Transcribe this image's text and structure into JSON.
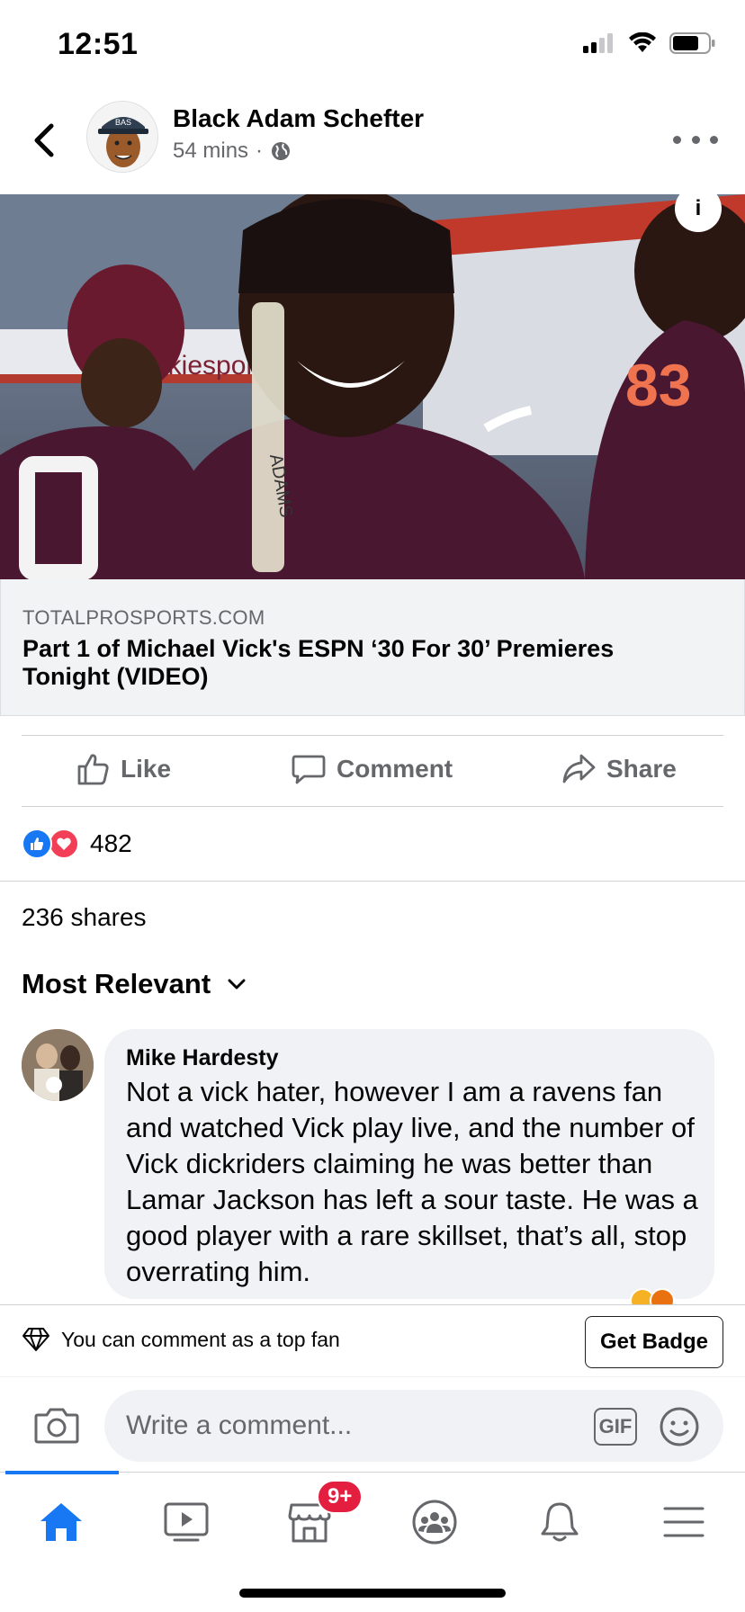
{
  "status_bar": {
    "time": "12:51"
  },
  "post": {
    "author": "Black Adam Schefter",
    "time_ago": "54 mins",
    "separator": "·",
    "avatar_text": "BAS"
  },
  "link": {
    "domain": "TOTALPROSPORTS.COM",
    "title": "Part 1 of Michael Vick's ESPN ‘30 For 30’ Premieres Tonight (VIDEO)",
    "image_text": {
      "jersey_number": "83",
      "sign_text": "okiespor",
      "strap_text": "ADAMS"
    },
    "info_glyph": "i"
  },
  "actions": {
    "like": "Like",
    "comment": "Comment",
    "share": "Share"
  },
  "reactions": {
    "count": "482",
    "types": [
      "like",
      "love"
    ]
  },
  "shares": "236 shares",
  "sort": {
    "label": "Most Relevant"
  },
  "comment": {
    "author": "Mike Hardesty",
    "text": "Not a vick hater, however I am a ravens fan and watched Vick play live, and the number of Vick dickriders claiming he was better than Lamar Jackson has left a sour taste. He was a good player with a rare skillset, that’s all, stop overrating him."
  },
  "top_fan": {
    "message": "You can comment as a top fan",
    "button": "Get Badge"
  },
  "composer": {
    "placeholder": "Write a comment...",
    "gif_label": "GIF"
  },
  "tabs": {
    "items": [
      "home-icon",
      "watch-icon",
      "marketplace-icon",
      "groups-icon",
      "notifications-icon",
      "menu-icon"
    ],
    "active": "home",
    "marketplace_badge": "9+"
  },
  "colors": {
    "accent": "#1877f2",
    "badge": "#e41e3f",
    "love": "#f33e58",
    "maroon": "#4a1730"
  }
}
